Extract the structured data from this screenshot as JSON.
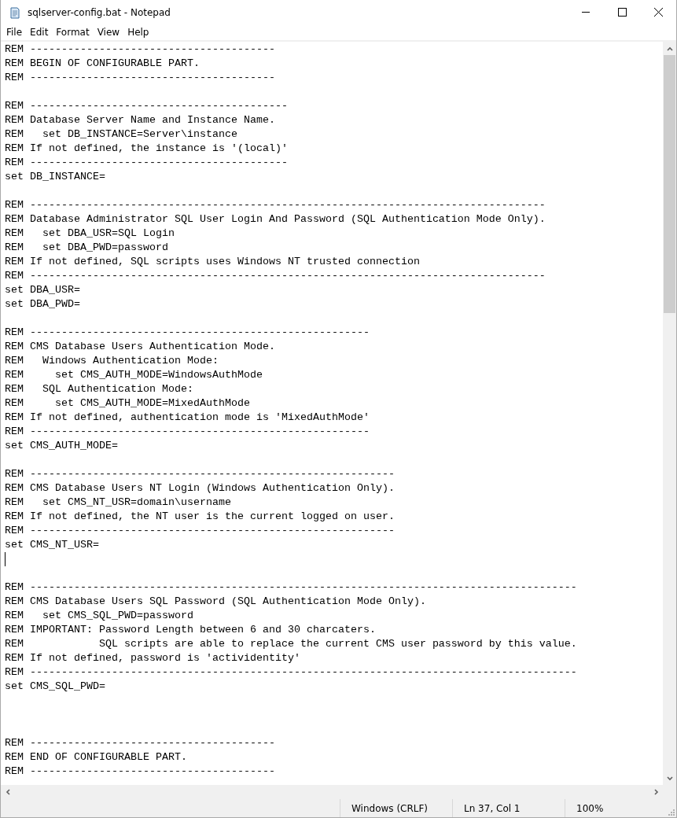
{
  "window": {
    "title": "sqlserver-config.bat - Notepad"
  },
  "menu": [
    "File",
    "Edit",
    "Format",
    "View",
    "Help"
  ],
  "lines": [
    {
      "kind": "text",
      "text": "REM ---------------------------------------"
    },
    {
      "kind": "text",
      "text": "REM BEGIN OF CONFIGURABLE PART."
    },
    {
      "kind": "text",
      "text": "REM ---------------------------------------"
    },
    {
      "kind": "blank"
    },
    {
      "kind": "text",
      "text": "REM -----------------------------------------"
    },
    {
      "kind": "text",
      "text": "REM Database Server Name and Instance Name."
    },
    {
      "kind": "text",
      "text": "REM   set DB_INSTANCE=Server\\instance"
    },
    {
      "kind": "text",
      "text": "REM If not defined, the instance is '(local)'"
    },
    {
      "kind": "text",
      "text": "REM -----------------------------------------"
    },
    {
      "kind": "text",
      "text": "set DB_INSTANCE="
    },
    {
      "kind": "blank"
    },
    {
      "kind": "text",
      "text": "REM ----------------------------------------------------------------------------------"
    },
    {
      "kind": "text",
      "text": "REM Database Administrator SQL User Login And Password (SQL Authentication Mode Only)."
    },
    {
      "kind": "text",
      "text": "REM   set DBA_USR=SQL Login"
    },
    {
      "kind": "text",
      "text": "REM   set DBA_PWD=password"
    },
    {
      "kind": "text",
      "text": "REM If not defined, SQL scripts uses Windows NT trusted connection"
    },
    {
      "kind": "text",
      "text": "REM ----------------------------------------------------------------------------------"
    },
    {
      "kind": "text",
      "text": "set DBA_USR="
    },
    {
      "kind": "text",
      "text": "set DBA_PWD="
    },
    {
      "kind": "blank"
    },
    {
      "kind": "text",
      "text": "REM ------------------------------------------------------"
    },
    {
      "kind": "text",
      "text": "REM CMS Database Users Authentication Mode."
    },
    {
      "kind": "text",
      "text": "REM   Windows Authentication Mode:"
    },
    {
      "kind": "text",
      "text": "REM     set CMS_AUTH_MODE=WindowsAuthMode"
    },
    {
      "kind": "text",
      "text": "REM   SQL Authentication Mode:"
    },
    {
      "kind": "text",
      "text": "REM     set CMS_AUTH_MODE=MixedAuthMode"
    },
    {
      "kind": "text",
      "text": "REM If not defined, authentication mode is 'MixedAuthMode'"
    },
    {
      "kind": "text",
      "text": "REM ------------------------------------------------------"
    },
    {
      "kind": "text",
      "text": "set CMS_AUTH_MODE="
    },
    {
      "kind": "blank"
    },
    {
      "kind": "text",
      "text": "REM ----------------------------------------------------------"
    },
    {
      "kind": "text",
      "text": "REM CMS Database Users NT Login (Windows Authentication Only)."
    },
    {
      "kind": "text",
      "text": "REM   set CMS_NT_USR=domain\\username"
    },
    {
      "kind": "text",
      "text": "REM If not defined, the NT user is the current logged on user."
    },
    {
      "kind": "text",
      "text": "REM ----------------------------------------------------------"
    },
    {
      "kind": "text",
      "text": "set CMS_NT_USR="
    },
    {
      "kind": "caret"
    },
    {
      "kind": "blank"
    },
    {
      "kind": "text",
      "text": "REM ---------------------------------------------------------------------------------------"
    },
    {
      "kind": "text",
      "text": "REM CMS Database Users SQL Password (SQL Authentication Mode Only)."
    },
    {
      "kind": "text",
      "text": "REM   set CMS_SQL_PWD=password"
    },
    {
      "kind": "text",
      "text": "REM IMPORTANT: Password Length between 6 and 30 charcaters."
    },
    {
      "kind": "text",
      "text": "REM            SQL scripts are able to replace the current CMS user password by this value."
    },
    {
      "kind": "text",
      "text": "REM If not defined, password is 'actividentity'"
    },
    {
      "kind": "text",
      "text": "REM ---------------------------------------------------------------------------------------"
    },
    {
      "kind": "text",
      "text": "set CMS_SQL_PWD="
    },
    {
      "kind": "blank"
    },
    {
      "kind": "blank"
    },
    {
      "kind": "blank"
    },
    {
      "kind": "text",
      "text": "REM ---------------------------------------"
    },
    {
      "kind": "text",
      "text": "REM END OF CONFIGURABLE PART."
    },
    {
      "kind": "text",
      "text": "REM ---------------------------------------"
    }
  ],
  "status_bar": {
    "line_ending": "Windows (CRLF)",
    "position": "Ln 37, Col 1",
    "zoom": "100%"
  }
}
